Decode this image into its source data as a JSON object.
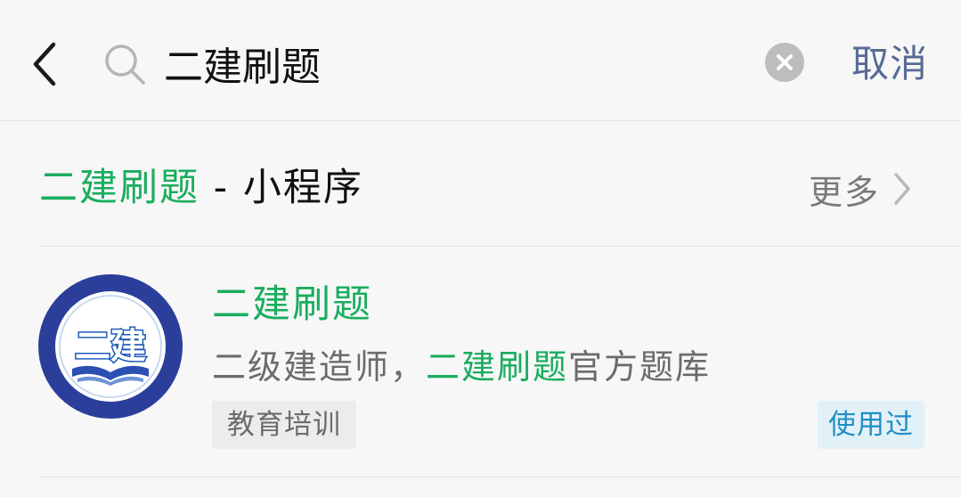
{
  "search": {
    "query": "二建刷题",
    "cancel_label": "取消"
  },
  "section": {
    "title_highlight": "二建刷题",
    "title_suffix": " - 小程序",
    "more_label": "更多"
  },
  "result": {
    "title": "二建刷题",
    "desc_prefix": "二级建造师，",
    "desc_highlight": "二建刷题",
    "desc_suffix": "官方题库",
    "logo_text": "二建",
    "category": "教育培训",
    "badge": "使用过"
  },
  "colors": {
    "highlight": "#1aad5e",
    "cancel": "#576b95",
    "badge": "#1f8fc5",
    "logo_ring": "#2b3f9a"
  },
  "icons": [
    "chevron-left-icon",
    "search-icon",
    "clear-icon",
    "chevron-right-icon"
  ]
}
